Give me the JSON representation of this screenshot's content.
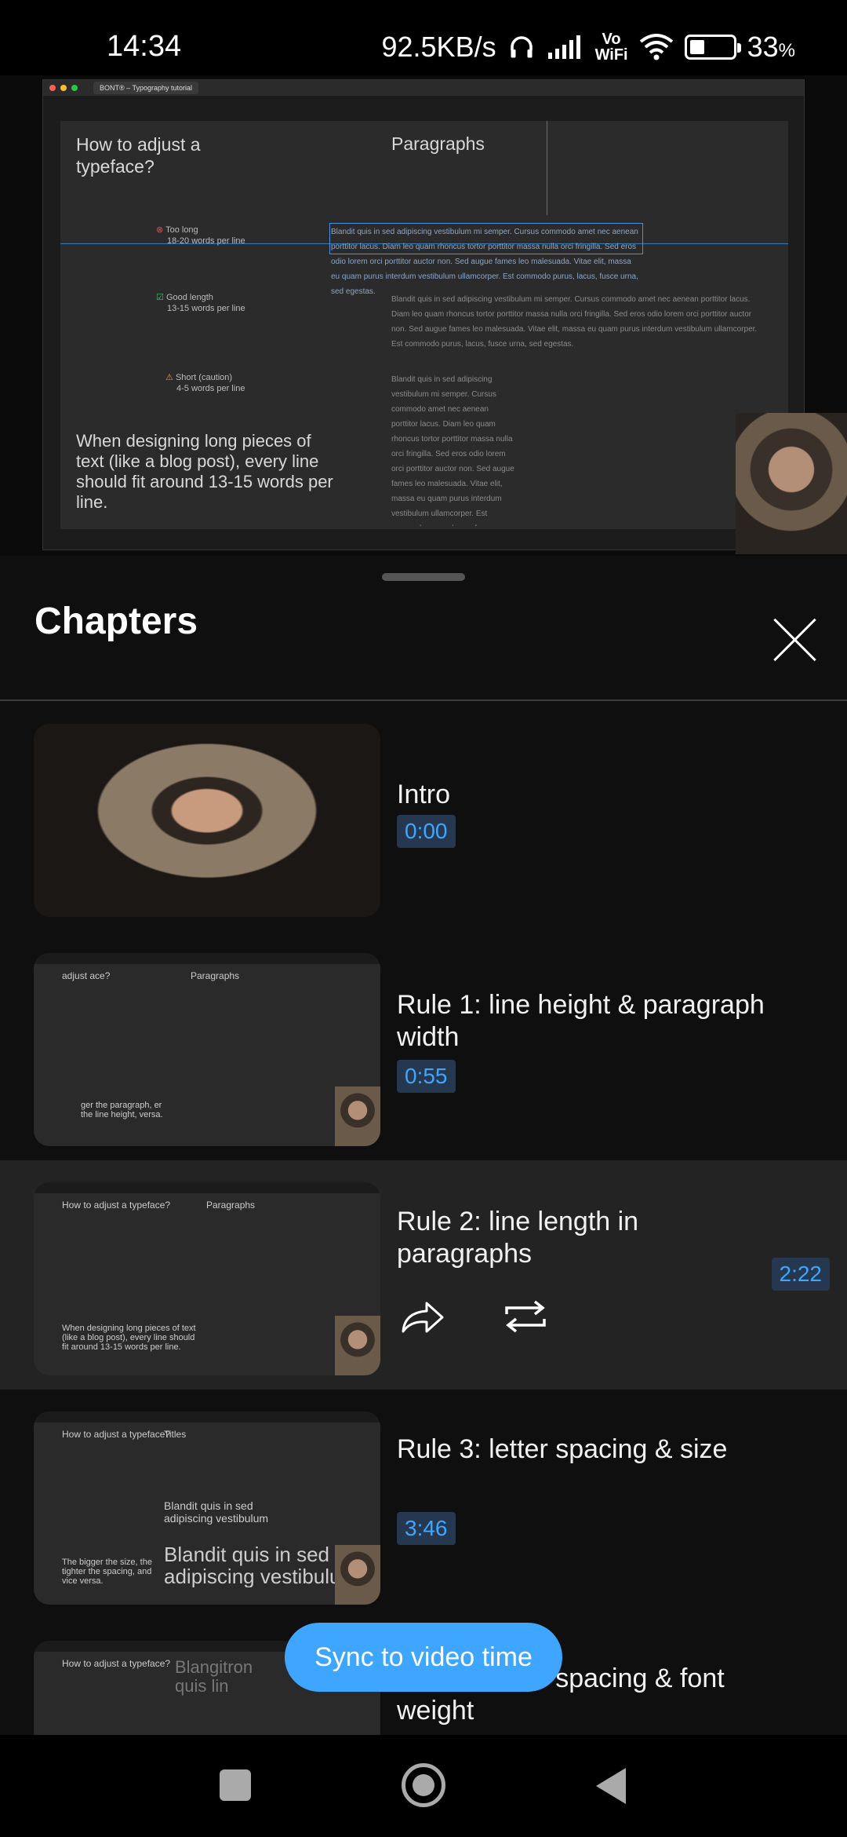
{
  "status_bar": {
    "time": "14:34",
    "net_speed": "92.5KB/s",
    "volte": "Vo\nWiFi",
    "battery_percent": "33",
    "battery_unit": "%"
  },
  "video": {
    "browser_tab": "BONT® – Typography tutorial",
    "canvas": {
      "heading": "How to adjust a typeface?",
      "section_title": "Paragraphs",
      "labels": [
        {
          "title": "Too long",
          "sub": "18-20 words per line"
        },
        {
          "title": "Good length",
          "sub": "13-15 words per line"
        },
        {
          "title": "Short (caution)",
          "sub": "4-5 words per line"
        }
      ],
      "sample_text": "Blandit quis in sed adipiscing vestibulum mi semper. Cursus commodo amet nec aenean porttitor lacus. Diam leo quam rhoncus tortor porttitor massa nulla orci fringilla. Sed eros odio lorem orci porttitor auctor non. Sed augue fames leo malesuada. Vitae elit, massa eu quam purus interdum vestibulum ullamcorper. Est commodo purus, lacus, fusce urna, sed egestas.",
      "body": "When designing long pieces of text (like a blog post), every line should fit around 13-15 words per line."
    }
  },
  "sheet": {
    "title": "Chapters",
    "sync_button": "Sync to video time"
  },
  "chapters": [
    {
      "title": "Intro",
      "time": "0:00"
    },
    {
      "title": "Rule 1: line height & paragraph width",
      "time": "0:55",
      "thumb_heading": "adjust ace?",
      "thumb_section": "Paragraphs",
      "thumb_body": "ger the paragraph, er the line height, versa."
    },
    {
      "title": "Rule 2: line length in paragraphs",
      "time": "2:22",
      "thumb_heading": "How to adjust a typeface?",
      "thumb_section": "Paragraphs",
      "thumb_body": "When designing long pieces of text (like a blog post), every line should fit around 13-15 words per line."
    },
    {
      "title": "Rule 3: letter spacing & size",
      "time": "3:46",
      "thumb_heading": "How to adjust a typeface?",
      "thumb_section": "Titles",
      "thumb_body": "The bigger the size, the tighter the spacing, and vice versa.",
      "thumb_sample": "Blandit quis in sed adipiscing vestibulum",
      "thumb_sample_large": "Blandit quis in sed adipiscing vestibulu"
    },
    {
      "title": "Rule 4: letter spacing & font weight",
      "thumb_heading": "How to adjust a typeface?",
      "thumb_sample": "Blangitron quis lin"
    }
  ]
}
